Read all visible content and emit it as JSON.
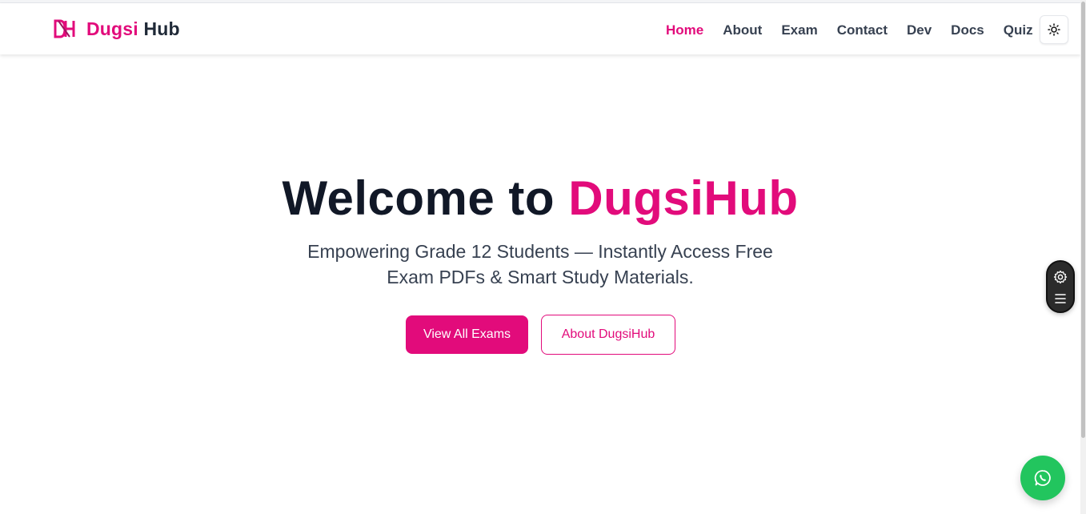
{
  "brand": {
    "part1": "Dugsi",
    "part2": "Hub",
    "logo_icon": "dh-monogram-icon"
  },
  "nav": {
    "items": [
      {
        "label": "Home",
        "active": true
      },
      {
        "label": "About",
        "active": false
      },
      {
        "label": "Exam",
        "active": false
      },
      {
        "label": "Contact",
        "active": false
      },
      {
        "label": "Dev",
        "active": false
      },
      {
        "label": "Docs",
        "active": false
      },
      {
        "label": "Quiz",
        "active": false
      }
    ],
    "theme_toggle_icon": "sun-icon"
  },
  "hero": {
    "title_prefix": "Welcome to",
    "title_accent": "DugsiHub",
    "subtitle": "Empowering Grade 12 Students — Instantly Access Free Exam PDFs & Smart Study Materials.",
    "primary_button": "View All Exams",
    "secondary_button": "About DugsiHub"
  },
  "floating": {
    "settings_icon": "gear-icon",
    "menu_icon": "hamburger-icon",
    "chat_icon": "whatsapp-icon"
  },
  "colors": {
    "accent": "#e20b7b",
    "dark": "#111827",
    "whatsapp": "#22c55e"
  }
}
